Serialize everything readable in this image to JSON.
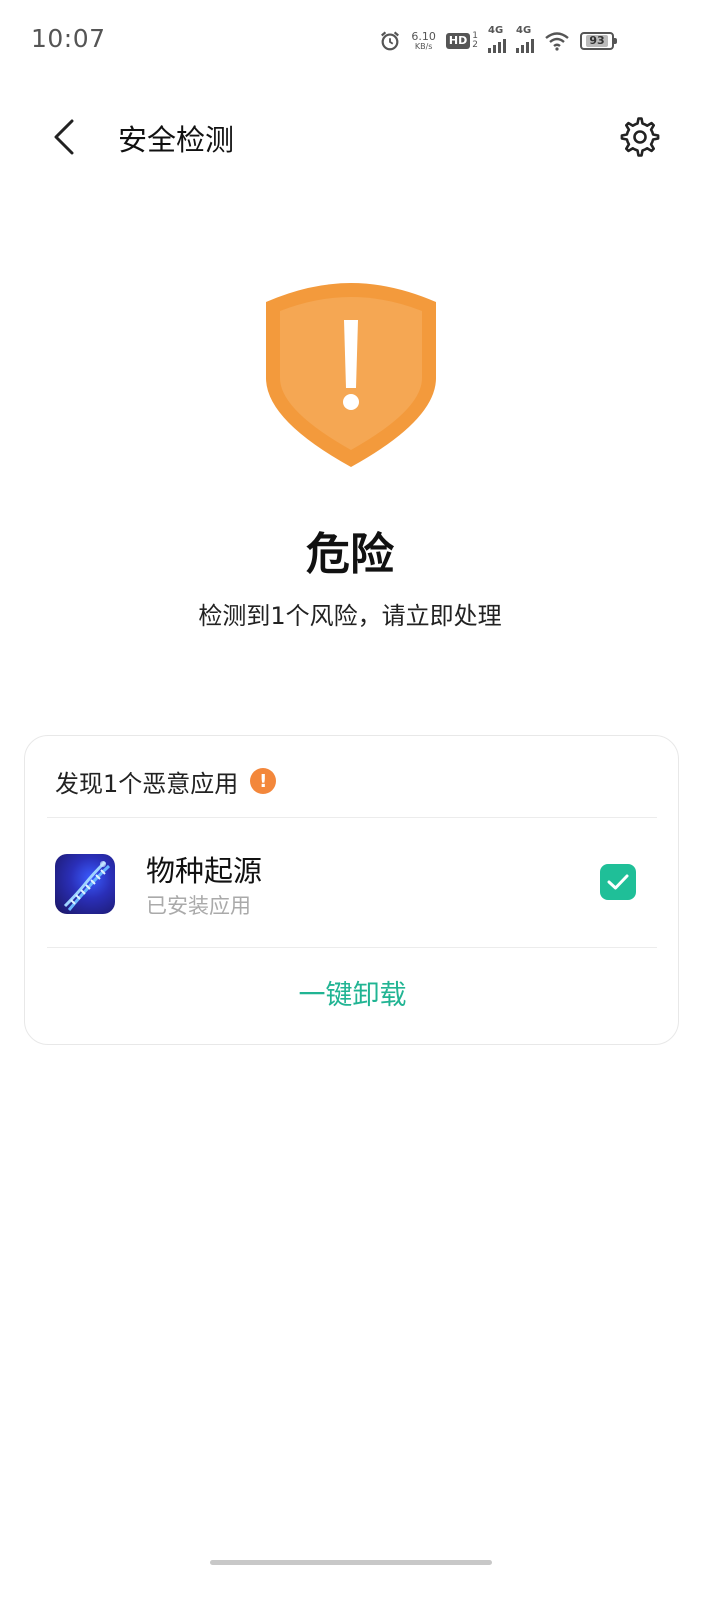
{
  "status_bar": {
    "time": "10:07",
    "net_speed_value": "6.10",
    "net_speed_unit": "KB/s",
    "hd_label": "HD",
    "hd_sim_top": "1",
    "hd_sim_bottom": "2",
    "sim1_label": "4G",
    "sim2_label": "4G",
    "battery": "93"
  },
  "header": {
    "title": "安全检测",
    "back_icon": "chevron-left-icon",
    "settings_icon": "gear-icon"
  },
  "status": {
    "icon": "warning-shield-icon",
    "title": "危险",
    "description": "检测到1个风险，请立即处理",
    "accent_color": "#f39a3c"
  },
  "card": {
    "title": "发现1个恶意应用",
    "badge": "!",
    "apps": [
      {
        "name": "物种起源",
        "subtitle": "已安装应用",
        "checked": true
      }
    ],
    "action_label": "一键卸载",
    "action_color": "#21b493"
  }
}
